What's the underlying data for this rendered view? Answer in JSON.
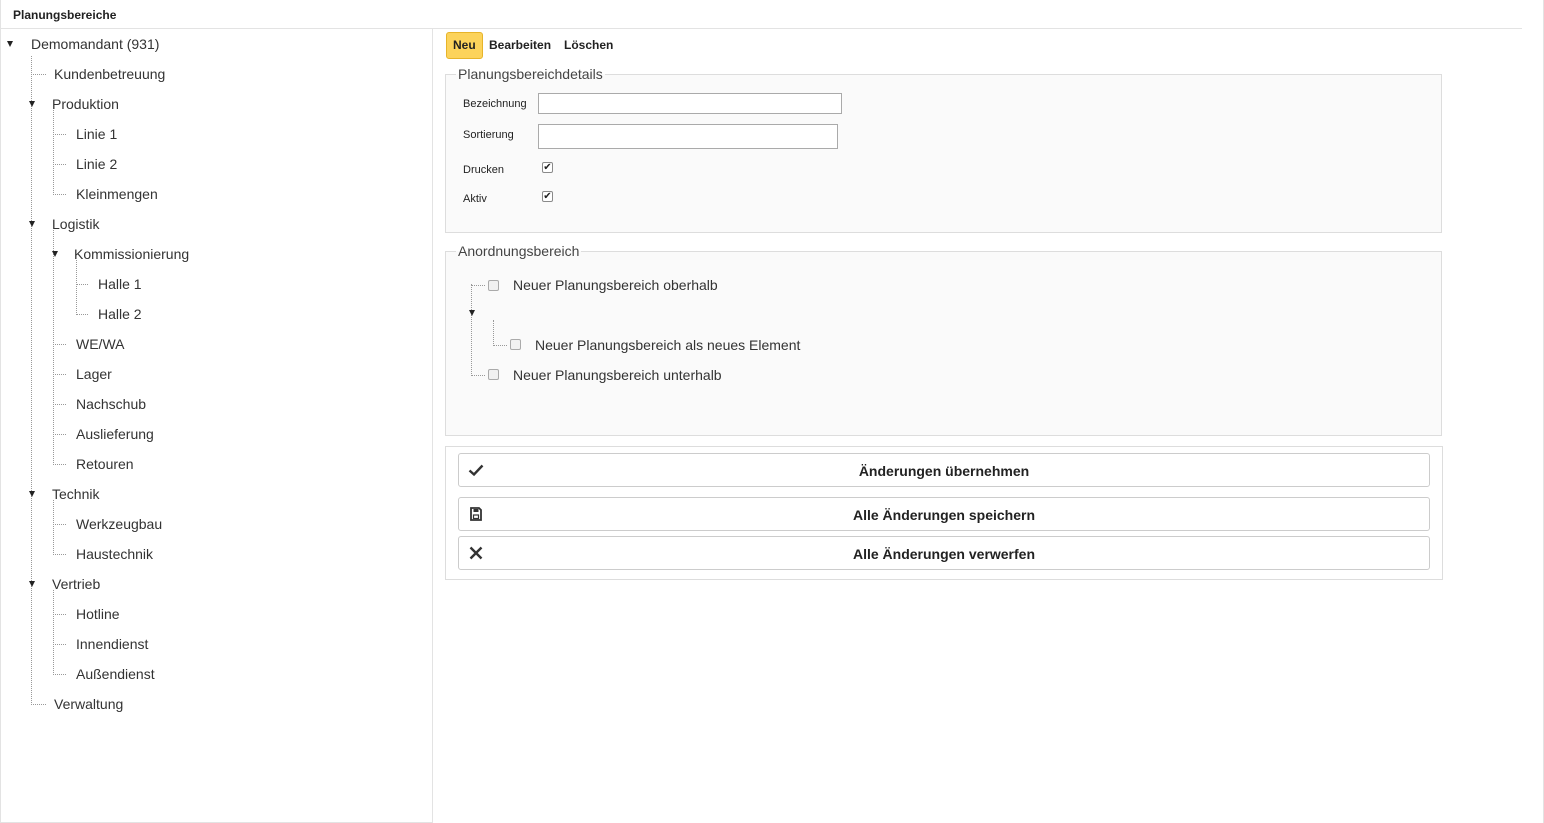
{
  "window": {
    "title": "Planungsbereiche"
  },
  "tree": {
    "root": {
      "label": "Demomandant (931)"
    },
    "items": [
      {
        "label": "Kundenbetreuung"
      },
      {
        "label": "Produktion"
      },
      {
        "label": "Linie 1"
      },
      {
        "label": "Linie 2"
      },
      {
        "label": "Kleinmengen"
      },
      {
        "label": "Logistik"
      },
      {
        "label": "Kommissionierung"
      },
      {
        "label": "Halle 1"
      },
      {
        "label": "Halle 2"
      },
      {
        "label": "WE/WA"
      },
      {
        "label": "Lager"
      },
      {
        "label": "Nachschub"
      },
      {
        "label": "Auslieferung"
      },
      {
        "label": "Retouren"
      },
      {
        "label": "Technik"
      },
      {
        "label": "Werkzeugbau"
      },
      {
        "label": "Haustechnik"
      },
      {
        "label": "Vertrieb"
      },
      {
        "label": "Hotline"
      },
      {
        "label": "Innendienst"
      },
      {
        "label": "Außendienst"
      },
      {
        "label": "Verwaltung"
      }
    ]
  },
  "toolbar": {
    "new_label": "Neu",
    "edit_label": "Bearbeiten",
    "delete_label": "Löschen"
  },
  "details": {
    "legend": "Planungsbereichdetails",
    "bezeichnung_label": "Bezeichnung",
    "bezeichnung_value": "",
    "sortierung_label": "Sortierung",
    "sortierung_value": "",
    "drucken_label": "Drucken",
    "drucken_checked": true,
    "aktiv_label": "Aktiv",
    "aktiv_checked": true
  },
  "arrangement": {
    "legend": "Anordnungsbereich",
    "above_label": "Neuer Planungsbereich oberhalb",
    "child_label": "Neuer Planungsbereich als neues Element",
    "below_label": "Neuer Planungsbereich unterhalb"
  },
  "actions": {
    "apply_label": "Änderungen übernehmen",
    "save_label": "Alle Änderungen speichern",
    "discard_label": "Alle Änderungen  verwerfen"
  }
}
